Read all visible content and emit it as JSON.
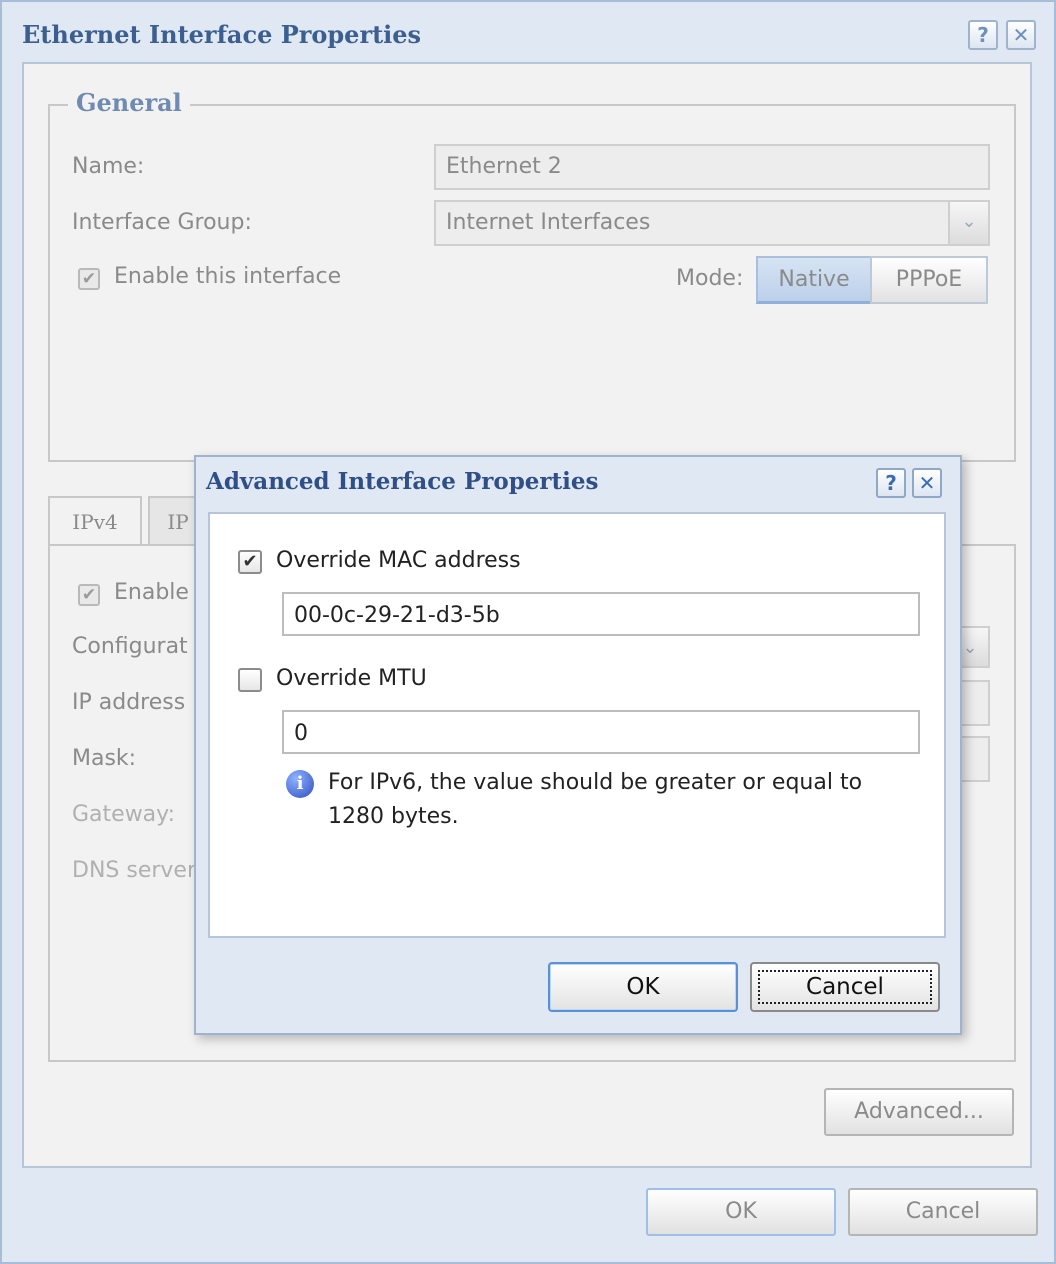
{
  "outer": {
    "title": "Ethernet Interface Properties",
    "help_label": "?",
    "close_label": "✕",
    "general": {
      "legend": "General",
      "name_label": "Name:",
      "name_value": "Ethernet 2",
      "group_label": "Interface Group:",
      "group_value": "Internet Interfaces",
      "enable_label": "Enable this interface",
      "mode_label": "Mode:",
      "modes": [
        "Native",
        "PPPoE"
      ],
      "selected_mode": "Native"
    },
    "tabs": [
      "IPv4",
      "IP"
    ],
    "ipv4": {
      "enable_label": "Enable",
      "config_label": "Configurat",
      "ip_label": "IP address",
      "mask_label": "Mask:",
      "gateway_label": "Gateway:",
      "dns_label": "DNS server"
    },
    "advanced_label": "Advanced...",
    "ok_label": "OK",
    "cancel_label": "Cancel"
  },
  "modal": {
    "title": "Advanced Interface Properties",
    "help_label": "?",
    "close_label": "✕",
    "override_mac_label": "Override MAC address",
    "override_mac_checked": true,
    "mac_value": "00-0c-29-21-d3-5b",
    "override_mtu_label": "Override MTU",
    "override_mtu_checked": false,
    "mtu_value": "0",
    "info_text_line1": "For IPv6, the value should be greater or equal to",
    "info_text_line2": "1280 bytes.",
    "ok_label": "OK",
    "cancel_label": "Cancel"
  },
  "icons": {
    "check": "✔",
    "chevron": "⌄",
    "info": "i"
  },
  "colors": {
    "window_bg": "#dfe8f3",
    "title_blue": "#3c5f8f",
    "modal_title": "#2f4f86",
    "panel_bg": "#f2f2f2"
  }
}
